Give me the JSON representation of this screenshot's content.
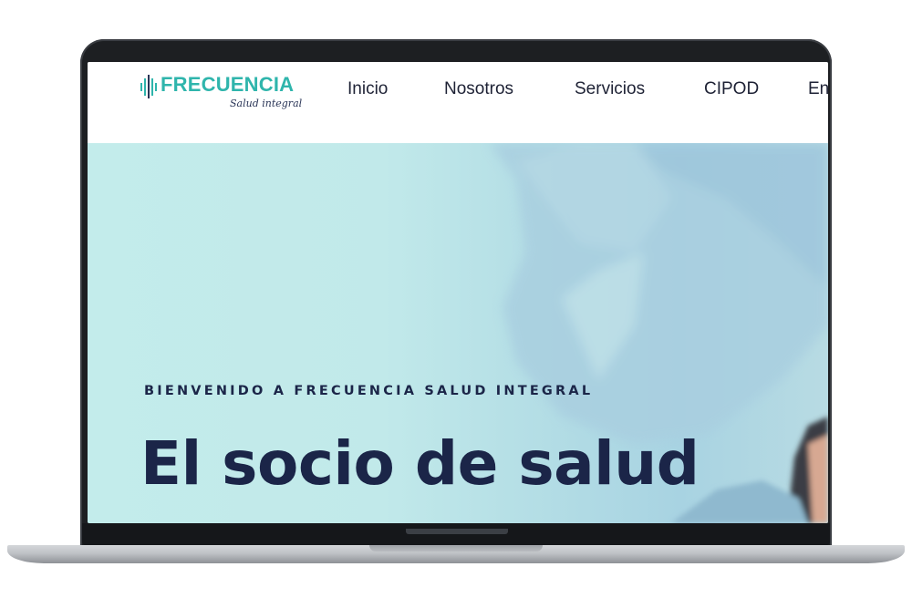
{
  "brand": {
    "name": "FRECUENCIA",
    "tagline": "Salud integral",
    "color": "#2fb5ac"
  },
  "nav": {
    "items": [
      {
        "label": "Inicio"
      },
      {
        "label": "Nosotros"
      },
      {
        "label": "Servicios"
      },
      {
        "label": "CIPOD"
      },
      {
        "label": "En"
      }
    ]
  },
  "hero": {
    "eyebrow": "BIENVENIDO A FRECUENCIA SALUD INTEGRAL",
    "headline": "El socio de salud",
    "text_color": "#1b2548",
    "background_color": "#c6eced"
  },
  "icons": {
    "logo": "sound-wave-icon"
  }
}
